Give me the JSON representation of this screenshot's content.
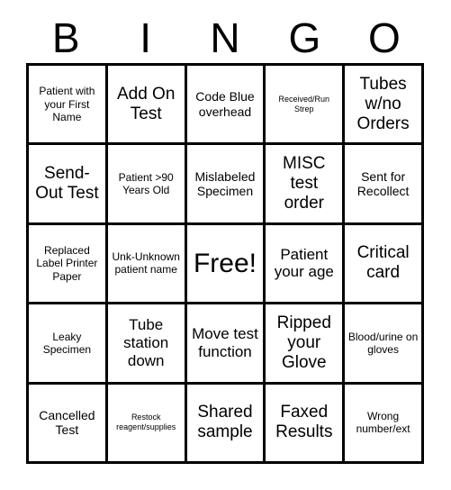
{
  "card": {
    "title_letters": [
      "B",
      "I",
      "N",
      "G",
      "O"
    ],
    "free_space_label": "Free!",
    "colors": {
      "grid_line": "#000000",
      "background": "#ffffff",
      "text": "#000000"
    },
    "columns": 5,
    "rows": 5,
    "cells": [
      [
        {
          "text": "Patient with your First Name",
          "size": "sm"
        },
        {
          "text": "Add On Test",
          "size": "xl"
        },
        {
          "text": "Code Blue overhead",
          "size": "md"
        },
        {
          "text": "Received/Run Strep",
          "size": "xs"
        },
        {
          "text": "Tubes w/no Orders",
          "size": "xl"
        }
      ],
      [
        {
          "text": "Send-Out Test",
          "size": "xl"
        },
        {
          "text": "Patient >90 Years Old",
          "size": "sm"
        },
        {
          "text": "Mislabeled Specimen",
          "size": "md"
        },
        {
          "text": "MISC test order",
          "size": "xl"
        },
        {
          "text": "Sent for Recollect",
          "size": "md"
        }
      ],
      [
        {
          "text": "Replaced Label Printer Paper",
          "size": "sm"
        },
        {
          "text": "Unk-Unknown patient name",
          "size": "sm"
        },
        {
          "text": "Free!",
          "size": "free"
        },
        {
          "text": "Patient your age",
          "size": "lg"
        },
        {
          "text": "Critical card",
          "size": "xl"
        }
      ],
      [
        {
          "text": "Leaky Specimen",
          "size": "sm"
        },
        {
          "text": "Tube station down",
          "size": "lg"
        },
        {
          "text": "Move test function",
          "size": "lg"
        },
        {
          "text": "Ripped your Glove",
          "size": "xl"
        },
        {
          "text": "Blood/urine on gloves",
          "size": "sm"
        }
      ],
      [
        {
          "text": "Cancelled Test",
          "size": "md"
        },
        {
          "text": "Restock reagent/supplies",
          "size": "xs"
        },
        {
          "text": "Shared sample",
          "size": "xl"
        },
        {
          "text": "Faxed Results",
          "size": "xl"
        },
        {
          "text": "Wrong number/ext",
          "size": "sm"
        }
      ]
    ]
  }
}
